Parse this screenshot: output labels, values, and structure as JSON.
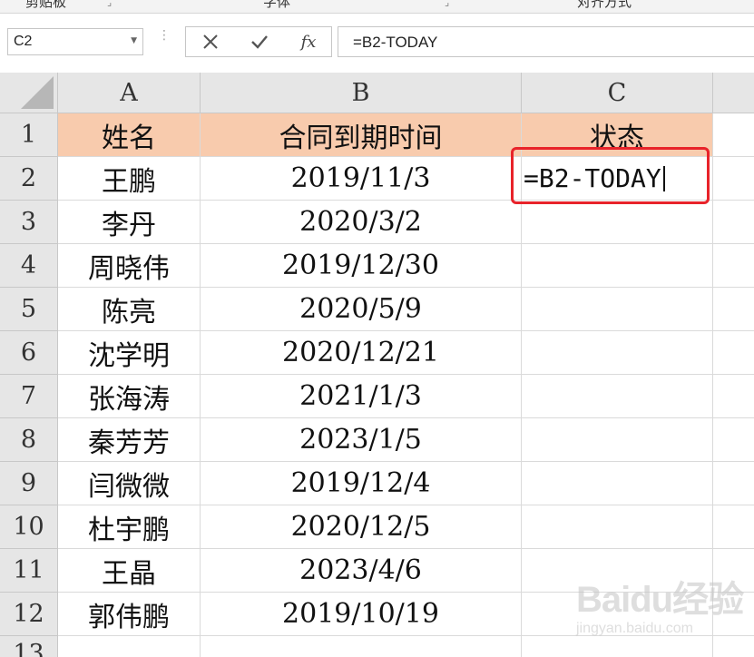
{
  "ribbon": {
    "groups": [
      "剪贴板",
      "字体",
      "对齐方式"
    ]
  },
  "formula_bar": {
    "name_box": "C2",
    "cancel_icon": "x-icon",
    "enter_icon": "check-icon",
    "fx_label": "fx",
    "formula": "=B2-TODAY"
  },
  "sheet": {
    "columns": [
      "A",
      "B",
      "C"
    ],
    "rows": [
      "1",
      "2",
      "3",
      "4",
      "5",
      "6",
      "7",
      "8",
      "9",
      "10",
      "11",
      "12",
      "13"
    ],
    "header": {
      "a": "姓名",
      "b": "合同到期时间",
      "c": "状态"
    },
    "data": [
      {
        "name": "王鹏",
        "date": "2019/11/3",
        "status": "=B2-TODAY"
      },
      {
        "name": "李丹",
        "date": "2020/3/2",
        "status": ""
      },
      {
        "name": "周晓伟",
        "date": "2019/12/30",
        "status": ""
      },
      {
        "name": "陈亮",
        "date": "2020/5/9",
        "status": ""
      },
      {
        "name": "沈学明",
        "date": "2020/12/21",
        "status": ""
      },
      {
        "name": "张海涛",
        "date": "2021/1/3",
        "status": ""
      },
      {
        "name": "秦芳芳",
        "date": "2023/1/5",
        "status": ""
      },
      {
        "name": "闫微微",
        "date": "2019/12/4",
        "status": ""
      },
      {
        "name": "杜宇鹏",
        "date": "2020/12/5",
        "status": ""
      },
      {
        "name": "王晶",
        "date": "2023/4/6",
        "status": ""
      },
      {
        "name": "郭伟鹏",
        "date": "2019/10/19",
        "status": ""
      }
    ]
  },
  "colors": {
    "header_fill": "#f8cbad",
    "highlight": "#e8232a"
  },
  "watermark": {
    "main": "Baidu经验",
    "sub": "jingyan.baidu.com"
  }
}
